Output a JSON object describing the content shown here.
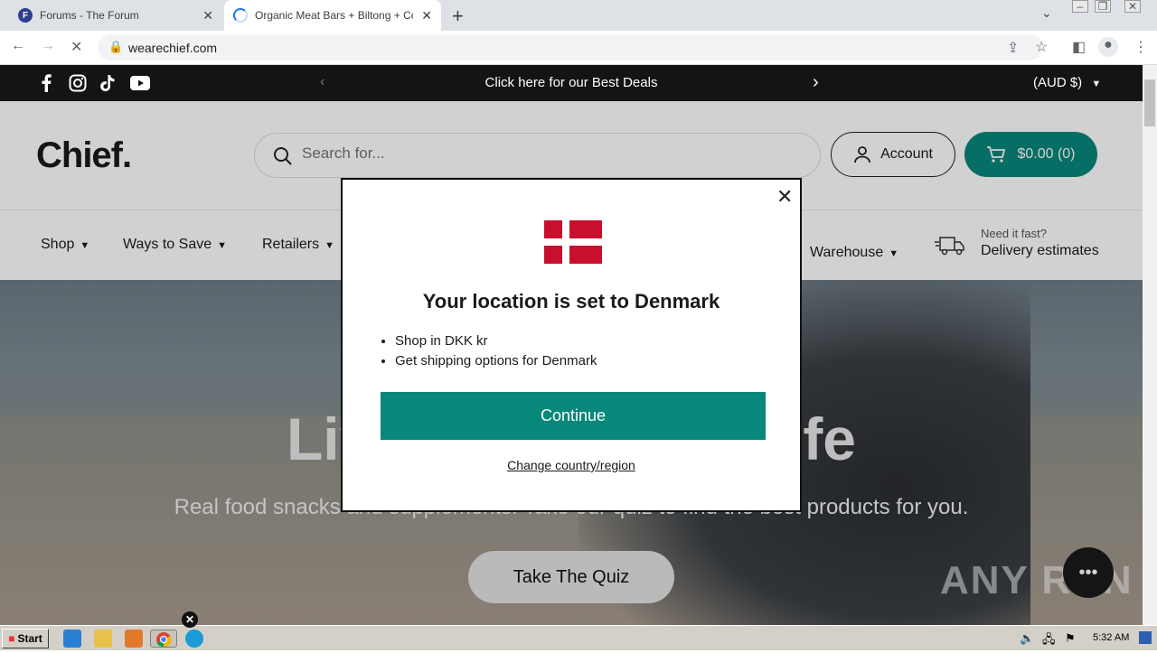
{
  "browser": {
    "tabs": [
      {
        "title": "Forums - The Forum",
        "favicon": "F"
      },
      {
        "title": "Organic Meat Bars + Biltong + Collagen",
        "loading": true
      }
    ],
    "new_tab": "+",
    "url": "wearechief.com"
  },
  "announcement": {
    "text": "Click here for our Best Deals",
    "currency": "(AUD $)"
  },
  "header": {
    "logo": "Chief.",
    "search_placeholder": "Search for...",
    "account_label": "Account",
    "cart_label": "$0.00 (0)"
  },
  "nav": {
    "items": [
      "Shop",
      "Ways to Save",
      "Retailers",
      "Warehouse"
    ],
    "delivery_small": "Need it fast?",
    "delivery_big": "Delivery estimates"
  },
  "hero": {
    "title_left": "Liv",
    "title_right": "fe",
    "subtitle": "Real food snacks and supplements. Take our quiz to find the best products for you.",
    "quiz_button": "Take The Quiz",
    "watermark": "ANY RUN"
  },
  "modal": {
    "title": "Your location is set to Denmark",
    "bullets": [
      "Shop in DKK kr",
      "Get shipping options for Denmark"
    ],
    "continue_label": "Continue",
    "change_label": "Change country/region",
    "flag": "denmark-flag",
    "colors": {
      "accent": "#08877b",
      "flag_red": "#c8102e"
    }
  },
  "taskbar": {
    "start_label": "Start",
    "clock": "5:32 AM"
  }
}
